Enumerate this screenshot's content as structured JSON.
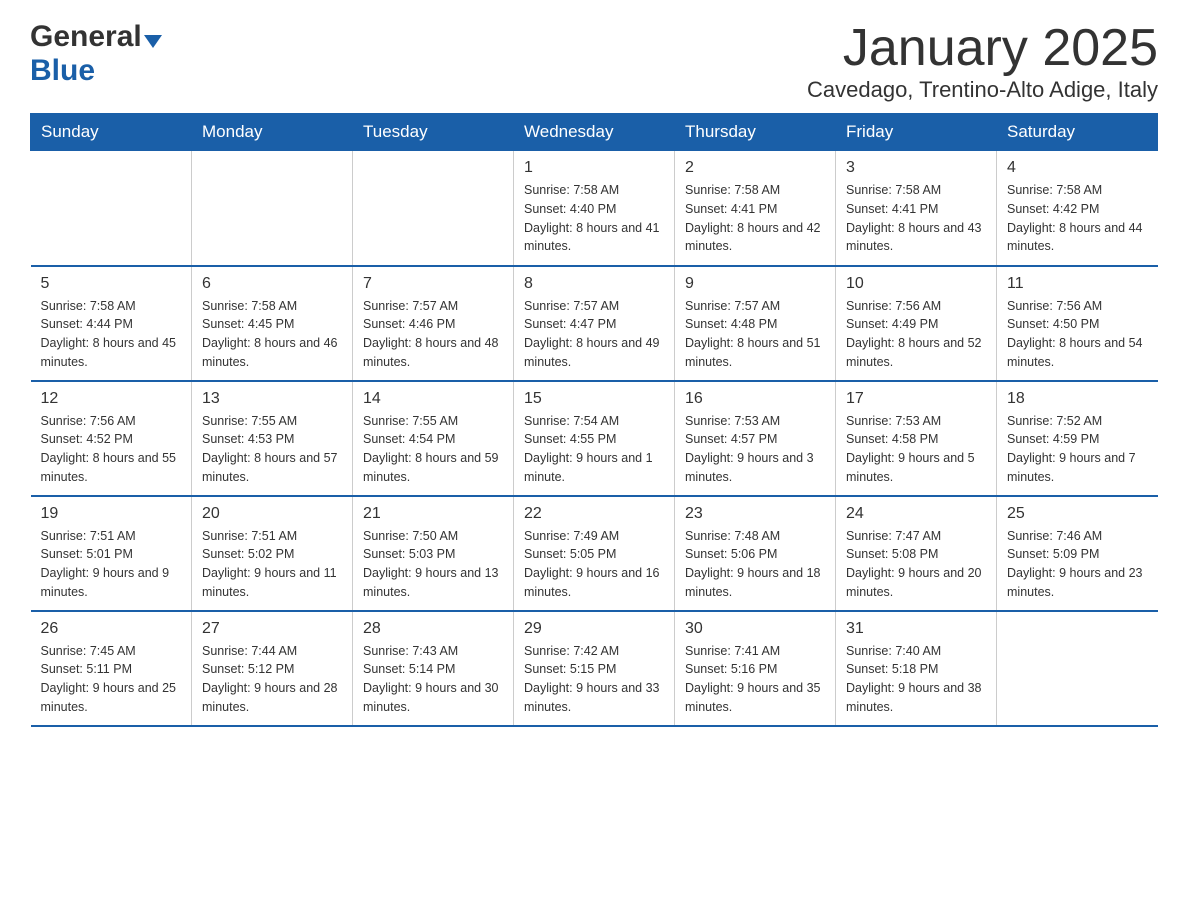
{
  "header": {
    "logo": {
      "general": "General",
      "triangle": "",
      "blue": "Blue"
    },
    "title": "January 2025",
    "subtitle": "Cavedago, Trentino-Alto Adige, Italy"
  },
  "weekdays": [
    "Sunday",
    "Monday",
    "Tuesday",
    "Wednesday",
    "Thursday",
    "Friday",
    "Saturday"
  ],
  "weeks": [
    [
      {
        "day": "",
        "info": ""
      },
      {
        "day": "",
        "info": ""
      },
      {
        "day": "",
        "info": ""
      },
      {
        "day": "1",
        "info": "Sunrise: 7:58 AM\nSunset: 4:40 PM\nDaylight: 8 hours\nand 41 minutes."
      },
      {
        "day": "2",
        "info": "Sunrise: 7:58 AM\nSunset: 4:41 PM\nDaylight: 8 hours\nand 42 minutes."
      },
      {
        "day": "3",
        "info": "Sunrise: 7:58 AM\nSunset: 4:41 PM\nDaylight: 8 hours\nand 43 minutes."
      },
      {
        "day": "4",
        "info": "Sunrise: 7:58 AM\nSunset: 4:42 PM\nDaylight: 8 hours\nand 44 minutes."
      }
    ],
    [
      {
        "day": "5",
        "info": "Sunrise: 7:58 AM\nSunset: 4:44 PM\nDaylight: 8 hours\nand 45 minutes."
      },
      {
        "day": "6",
        "info": "Sunrise: 7:58 AM\nSunset: 4:45 PM\nDaylight: 8 hours\nand 46 minutes."
      },
      {
        "day": "7",
        "info": "Sunrise: 7:57 AM\nSunset: 4:46 PM\nDaylight: 8 hours\nand 48 minutes."
      },
      {
        "day": "8",
        "info": "Sunrise: 7:57 AM\nSunset: 4:47 PM\nDaylight: 8 hours\nand 49 minutes."
      },
      {
        "day": "9",
        "info": "Sunrise: 7:57 AM\nSunset: 4:48 PM\nDaylight: 8 hours\nand 51 minutes."
      },
      {
        "day": "10",
        "info": "Sunrise: 7:56 AM\nSunset: 4:49 PM\nDaylight: 8 hours\nand 52 minutes."
      },
      {
        "day": "11",
        "info": "Sunrise: 7:56 AM\nSunset: 4:50 PM\nDaylight: 8 hours\nand 54 minutes."
      }
    ],
    [
      {
        "day": "12",
        "info": "Sunrise: 7:56 AM\nSunset: 4:52 PM\nDaylight: 8 hours\nand 55 minutes."
      },
      {
        "day": "13",
        "info": "Sunrise: 7:55 AM\nSunset: 4:53 PM\nDaylight: 8 hours\nand 57 minutes."
      },
      {
        "day": "14",
        "info": "Sunrise: 7:55 AM\nSunset: 4:54 PM\nDaylight: 8 hours\nand 59 minutes."
      },
      {
        "day": "15",
        "info": "Sunrise: 7:54 AM\nSunset: 4:55 PM\nDaylight: 9 hours\nand 1 minute."
      },
      {
        "day": "16",
        "info": "Sunrise: 7:53 AM\nSunset: 4:57 PM\nDaylight: 9 hours\nand 3 minutes."
      },
      {
        "day": "17",
        "info": "Sunrise: 7:53 AM\nSunset: 4:58 PM\nDaylight: 9 hours\nand 5 minutes."
      },
      {
        "day": "18",
        "info": "Sunrise: 7:52 AM\nSunset: 4:59 PM\nDaylight: 9 hours\nand 7 minutes."
      }
    ],
    [
      {
        "day": "19",
        "info": "Sunrise: 7:51 AM\nSunset: 5:01 PM\nDaylight: 9 hours\nand 9 minutes."
      },
      {
        "day": "20",
        "info": "Sunrise: 7:51 AM\nSunset: 5:02 PM\nDaylight: 9 hours\nand 11 minutes."
      },
      {
        "day": "21",
        "info": "Sunrise: 7:50 AM\nSunset: 5:03 PM\nDaylight: 9 hours\nand 13 minutes."
      },
      {
        "day": "22",
        "info": "Sunrise: 7:49 AM\nSunset: 5:05 PM\nDaylight: 9 hours\nand 16 minutes."
      },
      {
        "day": "23",
        "info": "Sunrise: 7:48 AM\nSunset: 5:06 PM\nDaylight: 9 hours\nand 18 minutes."
      },
      {
        "day": "24",
        "info": "Sunrise: 7:47 AM\nSunset: 5:08 PM\nDaylight: 9 hours\nand 20 minutes."
      },
      {
        "day": "25",
        "info": "Sunrise: 7:46 AM\nSunset: 5:09 PM\nDaylight: 9 hours\nand 23 minutes."
      }
    ],
    [
      {
        "day": "26",
        "info": "Sunrise: 7:45 AM\nSunset: 5:11 PM\nDaylight: 9 hours\nand 25 minutes."
      },
      {
        "day": "27",
        "info": "Sunrise: 7:44 AM\nSunset: 5:12 PM\nDaylight: 9 hours\nand 28 minutes."
      },
      {
        "day": "28",
        "info": "Sunrise: 7:43 AM\nSunset: 5:14 PM\nDaylight: 9 hours\nand 30 minutes."
      },
      {
        "day": "29",
        "info": "Sunrise: 7:42 AM\nSunset: 5:15 PM\nDaylight: 9 hours\nand 33 minutes."
      },
      {
        "day": "30",
        "info": "Sunrise: 7:41 AM\nSunset: 5:16 PM\nDaylight: 9 hours\nand 35 minutes."
      },
      {
        "day": "31",
        "info": "Sunrise: 7:40 AM\nSunset: 5:18 PM\nDaylight: 9 hours\nand 38 minutes."
      },
      {
        "day": "",
        "info": ""
      }
    ]
  ]
}
